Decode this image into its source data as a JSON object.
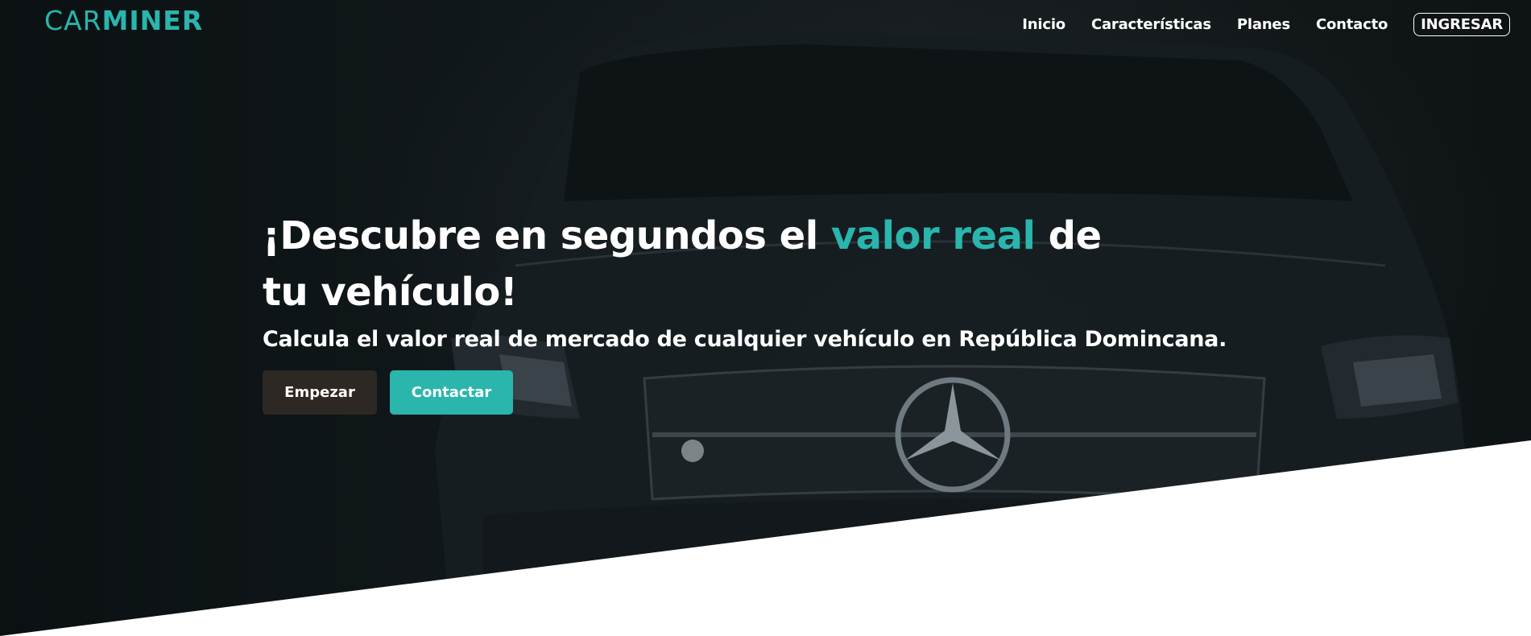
{
  "brand": {
    "logo_part1": "CAR",
    "logo_part2": "MINER"
  },
  "nav": {
    "items": [
      {
        "label": "Inicio"
      },
      {
        "label": "Características"
      },
      {
        "label": "Planes"
      },
      {
        "label": "Contacto"
      }
    ],
    "login_label": "INGRESAR"
  },
  "hero": {
    "headline_before": "¡Descubre en segundos el ",
    "headline_accent": "valor real",
    "headline_after": " de tu vehículo!",
    "subheadline": "Calcula el valor real de mercado de cualquier vehículo en República Domincana.",
    "primary_button": "Empezar",
    "secondary_button": "Contactar",
    "background_image": "dark-car-front-photo"
  },
  "colors": {
    "accent": "#2ab5ad",
    "dark_button": "#2e2824",
    "hero_background": "#11181b",
    "text": "#ffffff"
  }
}
